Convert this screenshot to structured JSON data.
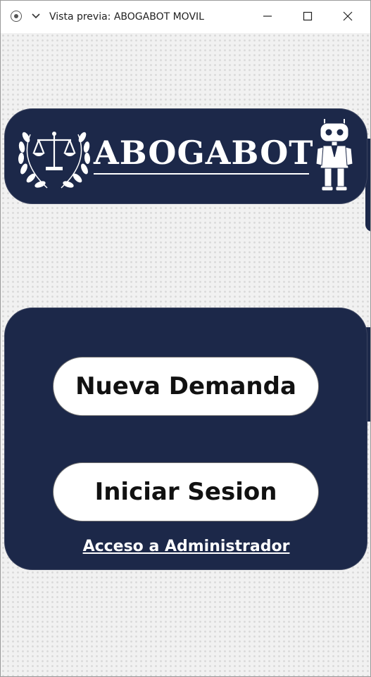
{
  "window": {
    "title": "Vista previa: ABOGABOT MOVIL",
    "icons": [
      "record-icon",
      "chevron-down-icon",
      "minimize-icon",
      "maximize-icon",
      "close-icon"
    ]
  },
  "logo": {
    "brand_text": "ABOGABOT",
    "icons": [
      "scales-of-justice-icon",
      "laurel-wreath-icon",
      "robot-lawyer-icon"
    ]
  },
  "actions": {
    "new_claim_label": "Nueva Demanda",
    "login_label": "Iniciar Sesion",
    "admin_link_label": "Acceso a Administrador"
  },
  "colors": {
    "navy": "#1c2849",
    "white": "#ffffff",
    "background": "#f1f1f1"
  }
}
